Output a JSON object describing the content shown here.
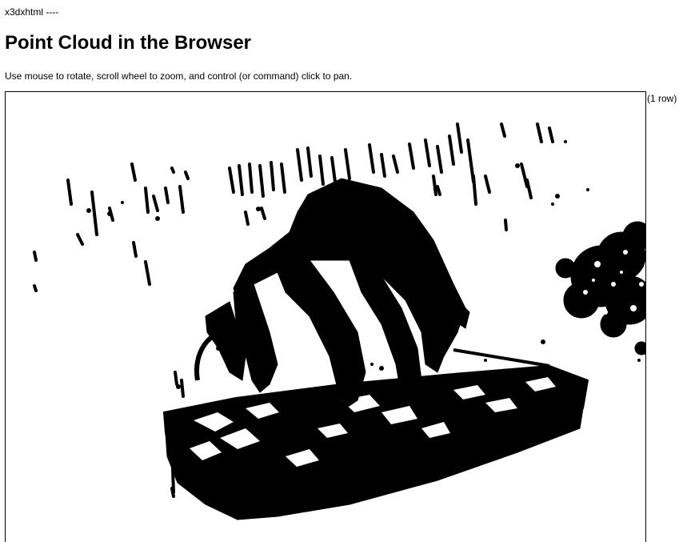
{
  "header": {
    "top_label": "x3dxhtml ----",
    "title": "Point Cloud in the Browser",
    "instructions": "Use mouse to rotate, scroll wheel to zoom, and control (or command) click to pan."
  },
  "viewer": {
    "point_color": "#000000",
    "background_color": "#ffffff"
  },
  "side": {
    "row_count": "(1 row)"
  }
}
